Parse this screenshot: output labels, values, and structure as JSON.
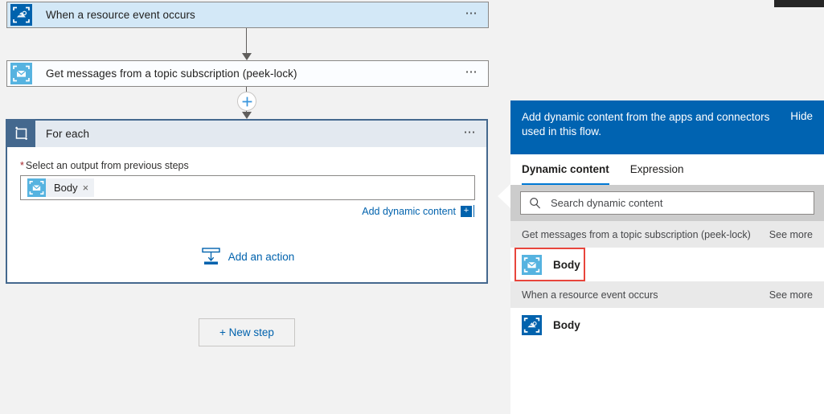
{
  "theme": {
    "accent_blue": "#0063b1",
    "link_blue": "#0062ad",
    "trigger_card_bg": "#d3e8f7",
    "foreach_border": "#44688e",
    "highlight_red": "#e8453c"
  },
  "canvas": {
    "trigger_card": {
      "title": "When a resource event occurs",
      "icon": "event-grid-icon",
      "menu": "⋯"
    },
    "action_card": {
      "title": "Get messages from a topic subscription (peek-lock)",
      "icon": "service-bus-icon",
      "menu": "⋯"
    },
    "foreach_card": {
      "title": "For each",
      "icon": "for-each-loop-icon",
      "menu": "⋯",
      "required_marker": "*",
      "field_label": "Select an output from previous steps",
      "token": {
        "label": "Body",
        "remove": "×",
        "icon": "service-bus-icon"
      },
      "add_dynamic_content": "Add dynamic content",
      "add_dynamic_plus": "+",
      "add_an_action": "Add an action"
    },
    "new_step_button": "+ New step"
  },
  "dynamic_panel": {
    "header_text": "Add dynamic content from the apps and connectors used in this flow.",
    "hide_label": "Hide",
    "tabs": [
      {
        "label": "Dynamic content",
        "active": true
      },
      {
        "label": "Expression",
        "active": false
      }
    ],
    "search": {
      "placeholder": "Search dynamic content",
      "value": "",
      "icon": "search-icon"
    },
    "groups": [
      {
        "name": "Get messages from a topic subscription (peek-lock)",
        "see_more": "See more",
        "items": [
          {
            "label": "Body",
            "icon": "service-bus-icon",
            "highlighted": true
          }
        ]
      },
      {
        "name": "When a resource event occurs",
        "see_more": "See more",
        "items": [
          {
            "label": "Body",
            "icon": "event-grid-icon",
            "highlighted": false
          }
        ]
      }
    ]
  }
}
